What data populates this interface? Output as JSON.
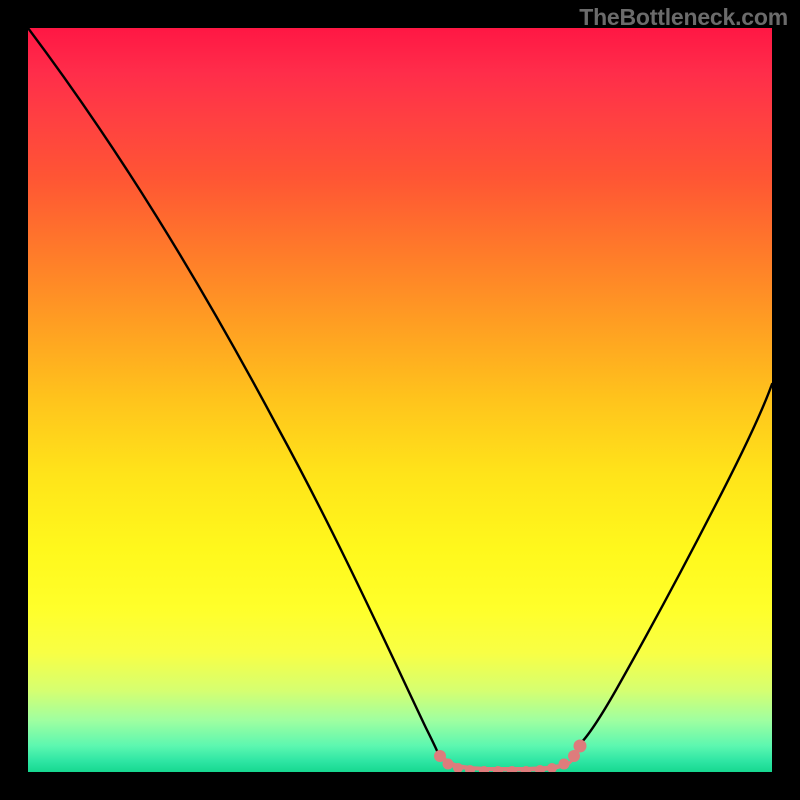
{
  "watermark": "TheBottleneck.com",
  "chart_data": {
    "type": "line",
    "title": "",
    "xlabel": "",
    "ylabel": "",
    "xlim": [
      0,
      100
    ],
    "ylim": [
      0,
      100
    ],
    "grid": false,
    "legend": false,
    "background_gradient": {
      "direction": "vertical",
      "stops": [
        {
          "pos": 0,
          "color": "#ff1744"
        },
        {
          "pos": 0.5,
          "color": "#ffc41c"
        },
        {
          "pos": 0.78,
          "color": "#ffff2a"
        },
        {
          "pos": 1.0,
          "color": "#16d890"
        }
      ]
    },
    "series": [
      {
        "name": "left-curve",
        "color": "#000000",
        "x": [
          0,
          6,
          12,
          18,
          24,
          30,
          36,
          42,
          48,
          52,
          54,
          55
        ],
        "y": [
          100,
          91,
          82,
          73,
          64,
          54,
          44,
          33,
          20,
          10,
          4,
          2
        ]
      },
      {
        "name": "right-curve",
        "color": "#000000",
        "x": [
          74,
          76,
          78,
          80,
          83,
          86,
          90,
          94,
          98,
          100
        ],
        "y": [
          4,
          6,
          9,
          13,
          19,
          26,
          35,
          44,
          52,
          57
        ]
      },
      {
        "name": "bottom-marker-band",
        "color": "#e07a7a",
        "marker": "circle",
        "x": [
          55,
          56,
          58,
          60,
          62,
          64,
          66,
          68,
          70,
          72,
          74
        ],
        "y": [
          2,
          1,
          0.5,
          0.3,
          0.2,
          0.2,
          0.2,
          0.3,
          0.5,
          1,
          2
        ]
      }
    ],
    "annotations": []
  }
}
